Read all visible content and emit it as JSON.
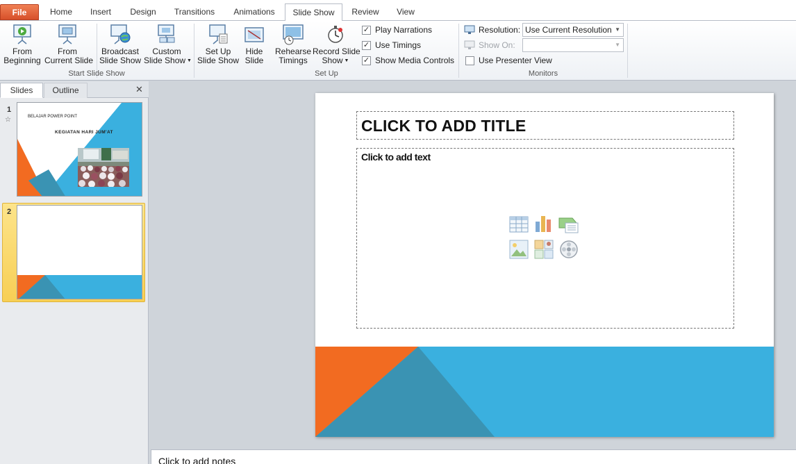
{
  "tabs": [
    {
      "label": "File"
    },
    {
      "label": "Home"
    },
    {
      "label": "Insert"
    },
    {
      "label": "Design"
    },
    {
      "label": "Transitions"
    },
    {
      "label": "Animations"
    },
    {
      "label": "Slide Show",
      "active": true
    },
    {
      "label": "Review"
    },
    {
      "label": "View"
    }
  ],
  "ribbon": {
    "start_group": {
      "label": "Start Slide Show",
      "buttons": [
        {
          "line1": "From",
          "line2": "Beginning",
          "icon": "slideshow-play-icon"
        },
        {
          "line1": "From",
          "line2": "Current Slide",
          "icon": "slideshow-current-icon"
        },
        {
          "line1": "Broadcast",
          "line2": "Slide Show",
          "icon": "broadcast-globe-icon"
        },
        {
          "line1": "Custom",
          "line2": "Slide Show",
          "icon": "custom-show-icon"
        }
      ]
    },
    "setup_group": {
      "label": "Set Up",
      "buttons": [
        {
          "line1": "Set Up",
          "line2": "Slide Show",
          "icon": "setup-show-icon"
        },
        {
          "line1": "Hide",
          "line2": "Slide",
          "icon": "hide-slide-icon"
        },
        {
          "line1": "Rehearse",
          "line2": "Timings",
          "icon": "rehearse-timer-icon"
        },
        {
          "line1": "Record Slide",
          "line2": "Show",
          "icon": "stopwatch-icon"
        }
      ],
      "checks": [
        {
          "label": "Play Narrations",
          "checked": true
        },
        {
          "label": "Use Timings",
          "checked": true
        },
        {
          "label": "Show Media Controls",
          "checked": true
        }
      ]
    },
    "monitors_group": {
      "label": "Monitors",
      "resolution_label": "Resolution:",
      "resolution_value": "Use Current Resolution",
      "show_on_label": "Show On:",
      "show_on_value": "",
      "presenter_view_label": "Use Presenter View",
      "presenter_view_checked": false
    }
  },
  "pane": {
    "tab_slides": "Slides",
    "tab_outline": "Outline",
    "close_glyph": "✕",
    "slides": [
      {
        "number": "1",
        "title": "BELAJAR POWER POINT",
        "subtitle": "KEGIATAN HARI JUM'AT",
        "has_animation_star": true
      },
      {
        "number": "2",
        "selected": true
      }
    ]
  },
  "slide": {
    "title_placeholder": "CLICK TO ADD TITLE",
    "body_placeholder": "Click to add text",
    "content_icons": [
      "insert-table-icon",
      "insert-chart-icon",
      "insert-smartart-icon",
      "insert-picture-icon",
      "insert-clipart-icon",
      "insert-media-icon"
    ]
  },
  "notes": {
    "placeholder": "Click to add notes"
  },
  "colors": {
    "orange": "#f26b21",
    "blue": "#3ab0df",
    "teal_overlap": "#3a93b3",
    "file_tab": "#e0592f",
    "selection": "#f7cf55"
  }
}
